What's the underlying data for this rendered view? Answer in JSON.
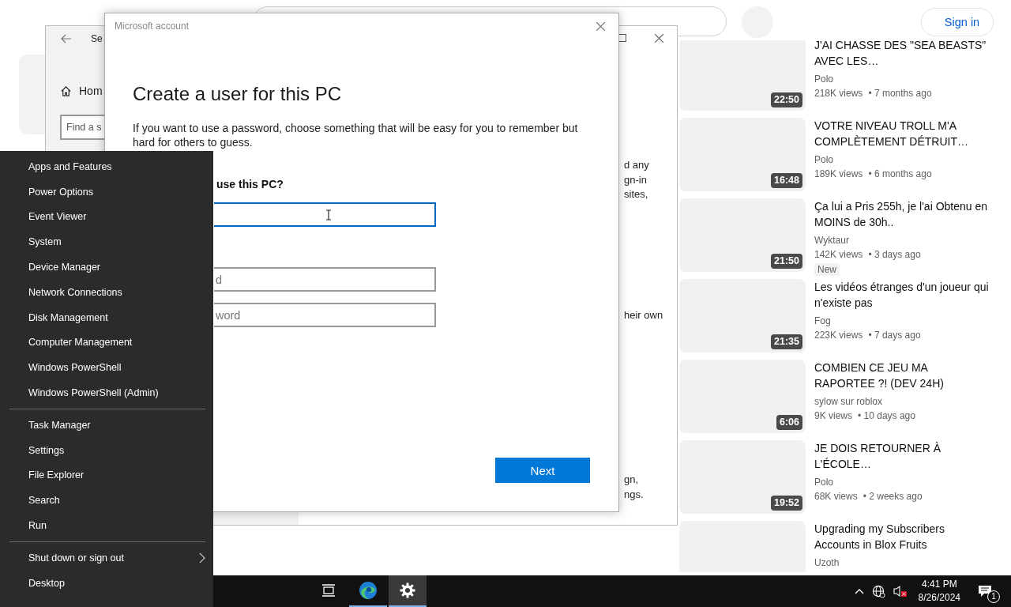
{
  "browser": {
    "sign_in": "Sign in",
    "videos": [
      {
        "title": "J'AI CHASSE DES \"SEA BEASTS\" AVEC LES…",
        "channel": "Polo",
        "views": "218K views",
        "age": "• 7 months ago",
        "duration": "22:50"
      },
      {
        "title": "VOTRE NIVEAU TROLL M'A COMPLÈTEMENT DÉTRUIT…",
        "channel": "Polo",
        "views": "189K views",
        "age": "• 6 months ago",
        "duration": "16:48"
      },
      {
        "title": "Ça lui a Pris 255h, je l'ai Obtenu en MOINS de 30h..",
        "channel": "Wyktaur",
        "views": "142K views",
        "age": "• 3 days ago",
        "duration": "21:50",
        "badge": "New"
      },
      {
        "title": "Les vidéos étranges d'un joueur qui n'existe pas",
        "channel": "Fog",
        "views": "223K views",
        "age": "• 7 days ago",
        "duration": "21:35"
      },
      {
        "title": "COMBIEN CE JEU MA RAPORTEE ?! (DEV 24H)",
        "channel": "sylow sur roblox",
        "views": "9K views",
        "age": "• 10 days ago",
        "duration": "6:06"
      },
      {
        "title": "JE DOIS RETOURNER À L'ÉCOLE…",
        "channel": "Polo",
        "views": "68K views",
        "age": "• 2 weeks ago",
        "duration": "19:52"
      },
      {
        "title": "Upgrading my Subscribers Accounts in Blox Fruits",
        "channel": "Uzoth"
      }
    ]
  },
  "settings_window": {
    "title": "Se",
    "home": "Hom",
    "search_placeholder": "Find a s",
    "fragment_groups": [
      [
        "d any",
        "gn-in",
        "sites,"
      ],
      [
        "heir own"
      ],
      [
        "gn,",
        "ngs."
      ]
    ]
  },
  "dialog": {
    "title": "Microsoft account",
    "heading": "Create a user for this PC",
    "text": "If you want to use a password, choose something that will be easy for you to remember but hard for others to guess.",
    "field_label": "use this PC?",
    "fields": [
      {
        "focused": true
      },
      {
        "placeholder": "d",
        "focused": false
      },
      {
        "placeholder": "word",
        "focused": false
      }
    ],
    "next": "Next"
  },
  "power_menu": {
    "groups": [
      [
        {
          "label": "Apps and Features",
          "submenu": false
        },
        {
          "label": "Power Options",
          "submenu": false
        },
        {
          "label": "Event Viewer",
          "submenu": false
        },
        {
          "label": "System",
          "submenu": false
        },
        {
          "label": "Device Manager",
          "submenu": false
        },
        {
          "label": "Network Connections",
          "submenu": false
        },
        {
          "label": "Disk Management",
          "submenu": false
        },
        {
          "label": "Computer Management",
          "submenu": false
        },
        {
          "label": "Windows PowerShell",
          "submenu": false
        },
        {
          "label": "Windows PowerShell (Admin)",
          "submenu": false
        }
      ],
      [
        {
          "label": "Task Manager",
          "submenu": false
        },
        {
          "label": "Settings",
          "submenu": false
        },
        {
          "label": "File Explorer",
          "submenu": false
        },
        {
          "label": "Search",
          "submenu": false
        },
        {
          "label": "Run",
          "submenu": false
        }
      ],
      [
        {
          "label": "Shut down or sign out",
          "submenu": true
        },
        {
          "label": "Desktop",
          "submenu": false
        }
      ]
    ]
  },
  "taskbar": {
    "apps": [
      {
        "kind": "task-view",
        "running": false,
        "selected": false
      },
      {
        "kind": "edge",
        "running": true,
        "selected": false
      },
      {
        "kind": "settings",
        "running": true,
        "selected": true
      }
    ],
    "time": "4:41 PM",
    "date": "8/26/2024",
    "notifications": "1"
  }
}
